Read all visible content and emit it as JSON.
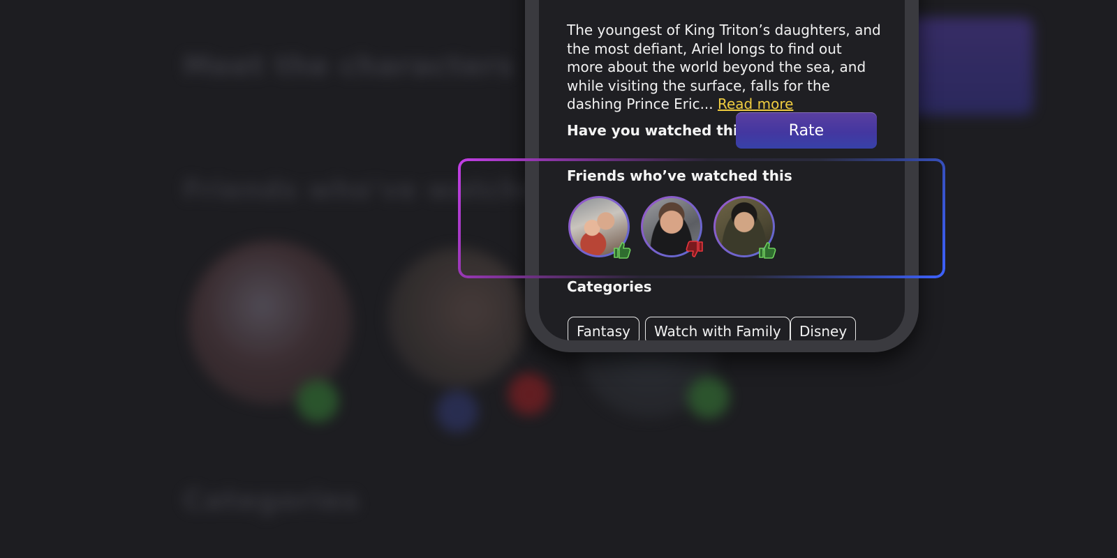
{
  "background": {
    "title_text": "Meet the characters",
    "subtitle_text": "Friends who've watched this",
    "categories_text": "Categories"
  },
  "movie": {
    "description": "The youngest of King Triton’s daughters, and the most defiant, Ariel longs to find out more about the world beyond the sea, and while visiting the surface, falls for the dashing Prince Eric...",
    "read_more_label": "Read more"
  },
  "rating": {
    "question": "Have you watched this?",
    "rate_label": "Rate"
  },
  "friends": {
    "title": "Friends who’ve watched this",
    "items": [
      {
        "name": "friend-1",
        "reaction": "thumbs-up"
      },
      {
        "name": "friend-2",
        "reaction": "thumbs-down"
      },
      {
        "name": "friend-3",
        "reaction": "thumbs-up"
      }
    ]
  },
  "categories": {
    "title": "Categories",
    "items": [
      "Fantasy",
      "Watch with Family",
      "Disney"
    ]
  },
  "colors": {
    "accent_purple": "#5a3fa0",
    "accent_blue": "#3d62ff",
    "link_yellow": "#f0cd40",
    "thumbs_up": "#67c75a",
    "thumbs_down": "#e0343c"
  }
}
